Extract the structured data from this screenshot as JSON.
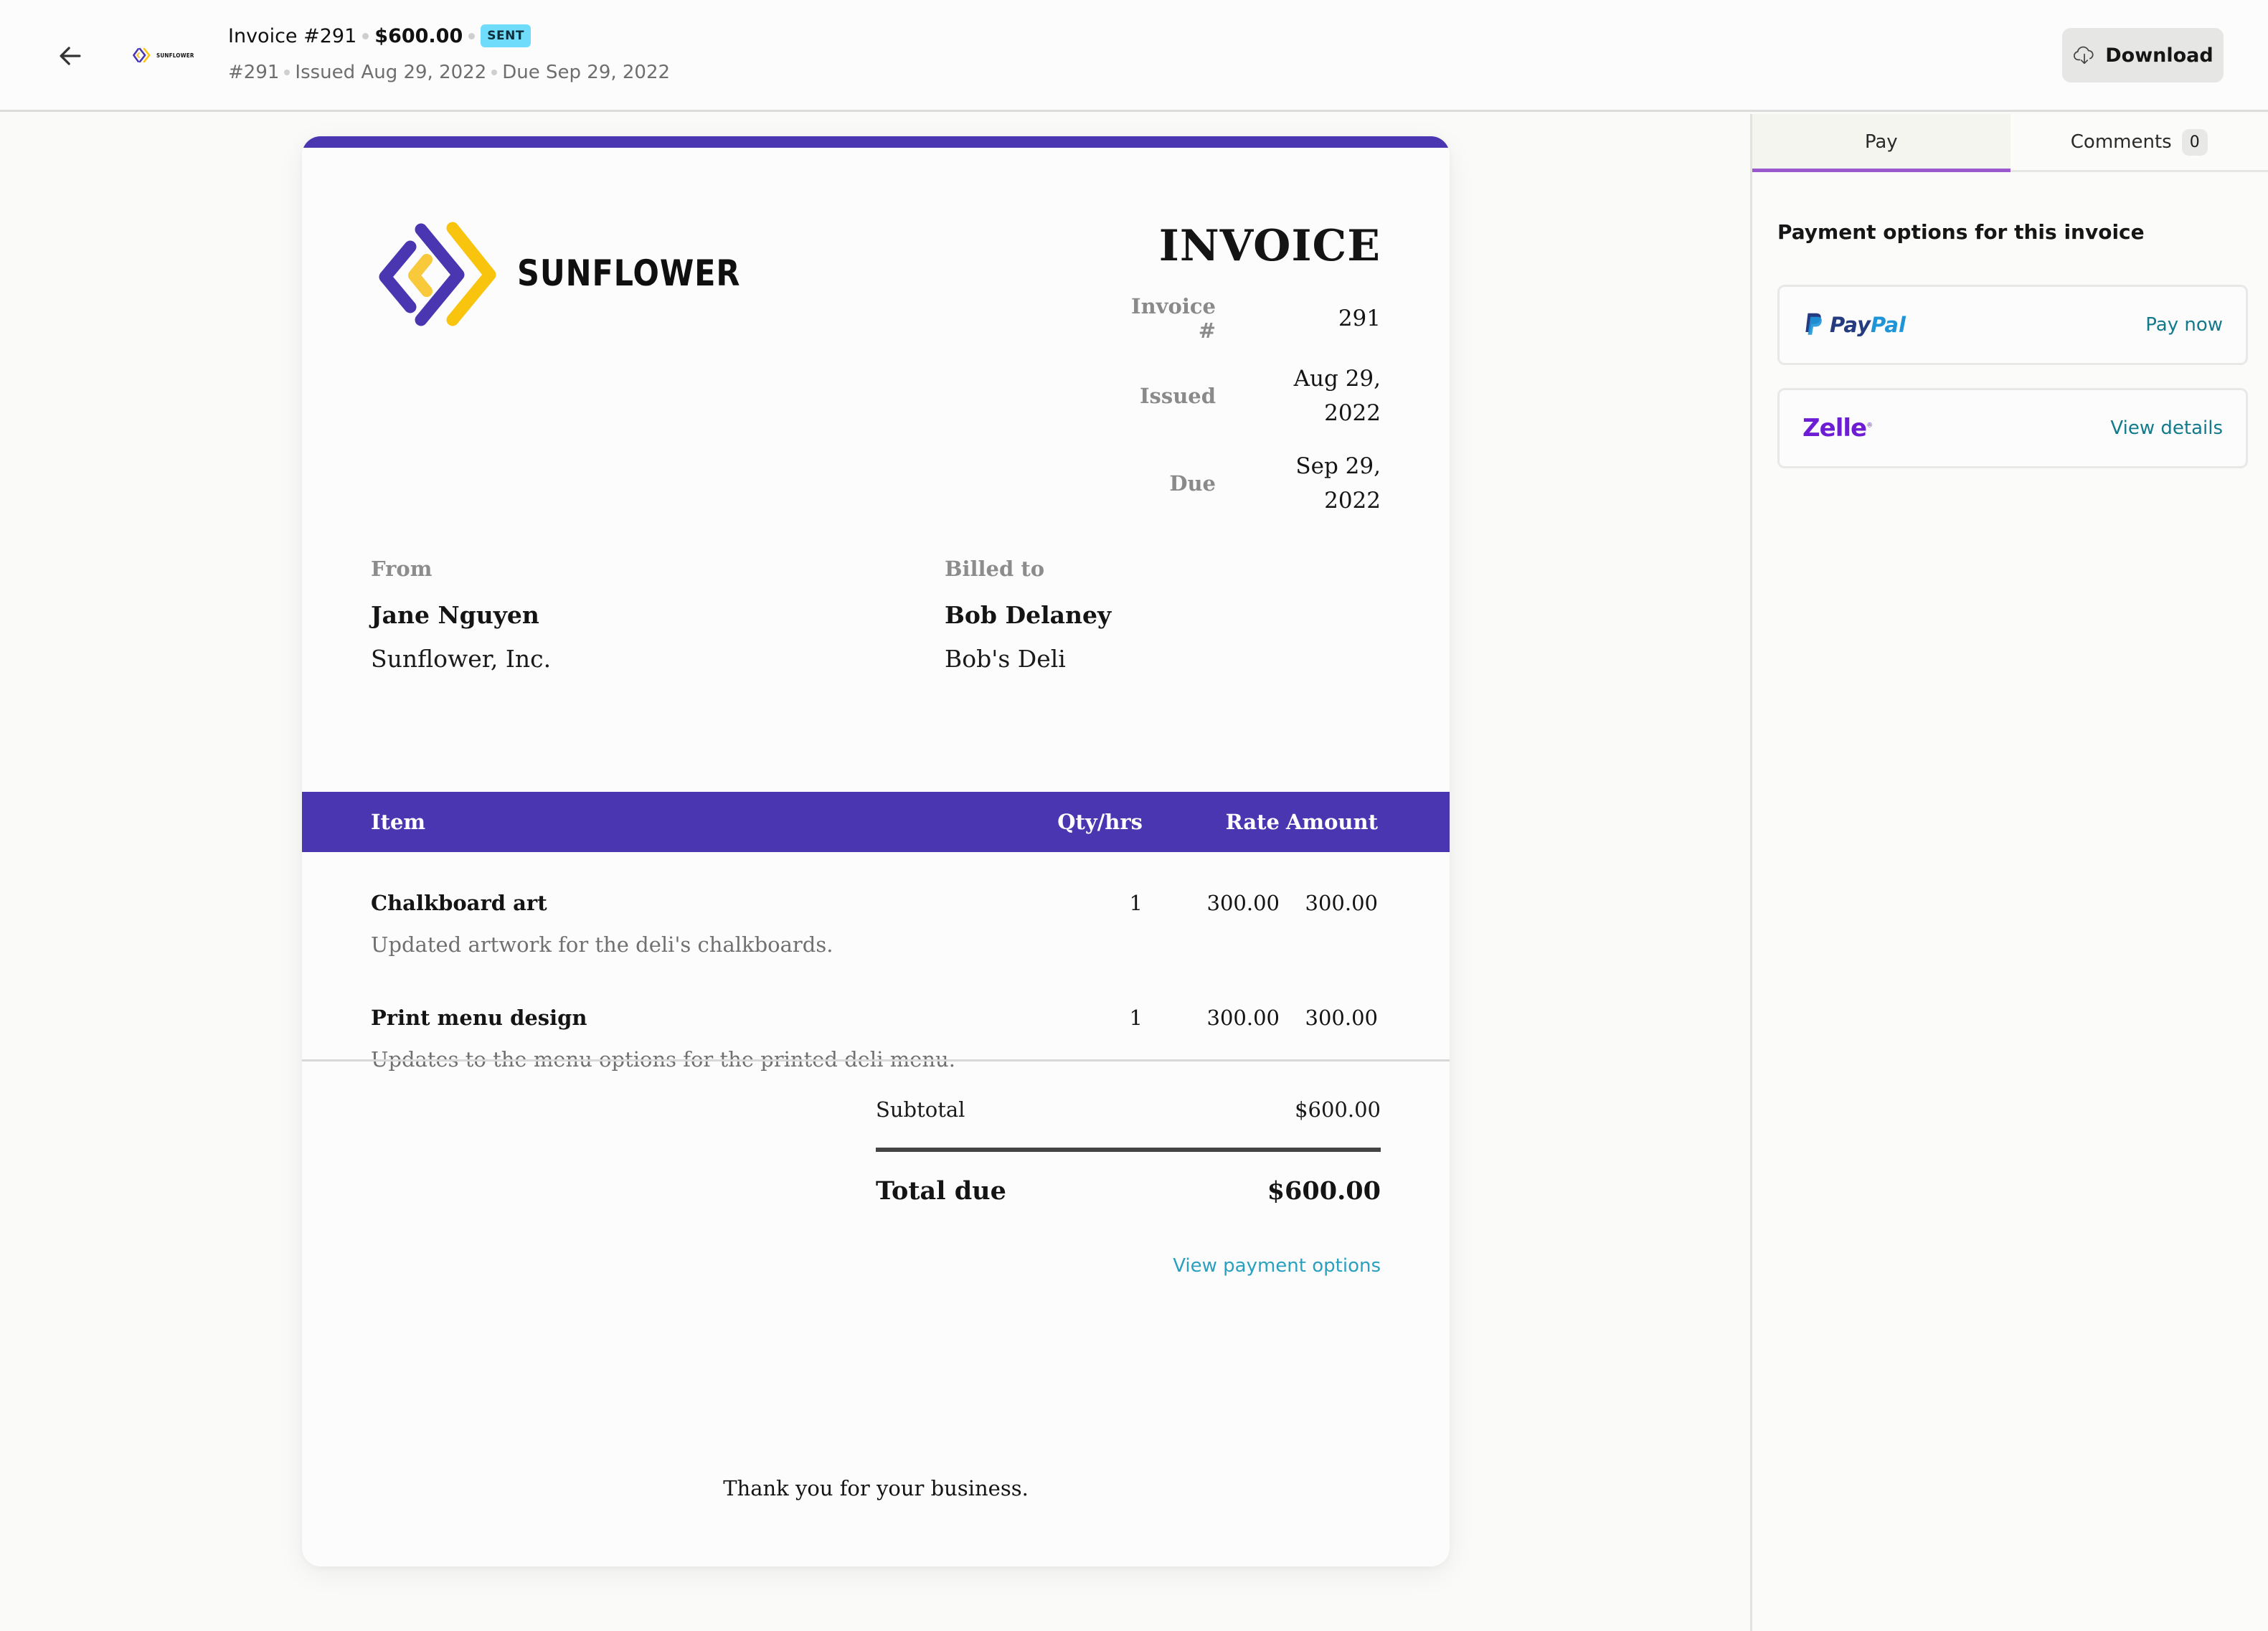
{
  "header": {
    "title": "Invoice #291",
    "amount": "$600.00",
    "status_badge": "SENT",
    "sub_number": "#291",
    "sub_issued": "Issued Aug 29, 2022",
    "sub_due": "Due Sep 29, 2022",
    "mini_logo_text": "SUNFLOWER",
    "download_label": "Download",
    "icons": {
      "back": "arrow-left-icon",
      "download": "cloud-download-icon"
    }
  },
  "invoice": {
    "brand_name": "SUNFLOWER",
    "title": "INVOICE",
    "meta": [
      {
        "label": "Invoice #",
        "value": "291"
      },
      {
        "label": "Issued",
        "value": "Aug 29, 2022"
      },
      {
        "label": "Due",
        "value": "Sep 29, 2022"
      }
    ],
    "from": {
      "label": "From",
      "name": "Jane Nguyen",
      "org": "Sunflower, Inc."
    },
    "billed_to": {
      "label": "Billed to",
      "name": "Bob Delaney",
      "org": "Bob's Deli"
    },
    "columns": {
      "item": "Item",
      "qty": "Qty/hrs",
      "rate": "Rate",
      "amount": "Amount"
    },
    "items": [
      {
        "name": "Chalkboard art",
        "description": "Updated artwork for the deli's chalkboards.",
        "qty": "1",
        "rate": "300.00",
        "amount": "300.00"
      },
      {
        "name": "Print menu design",
        "description": "Updates to the menu options for the printed deli menu.",
        "qty": "1",
        "rate": "300.00",
        "amount": "300.00"
      }
    ],
    "subtotal_label": "Subtotal",
    "subtotal_value": "$600.00",
    "total_label": "Total due",
    "total_value": "$600.00",
    "view_payment_link": "View payment options",
    "thanks": "Thank you for your business.",
    "colors": {
      "accent": "#4b36b2",
      "logo_yellow": "#f9c40e",
      "link": "#2aa0c0"
    }
  },
  "side": {
    "tabs": [
      {
        "label": "Pay",
        "active": true
      },
      {
        "label": "Comments",
        "count": "0",
        "active": false
      }
    ],
    "heading": "Payment options for this invoice",
    "options": [
      {
        "provider": "PayPal",
        "logo_a": "Pay",
        "logo_b": "Pal",
        "action": "Pay now",
        "icon": "paypal-icon"
      },
      {
        "provider": "Zelle",
        "logo": "Zelle",
        "action": "View details",
        "icon": "zelle-icon"
      }
    ],
    "colors": {
      "tab_indicator": "#9b59d0",
      "action": "#137a8c",
      "zelle": "#6d1ed4"
    }
  }
}
